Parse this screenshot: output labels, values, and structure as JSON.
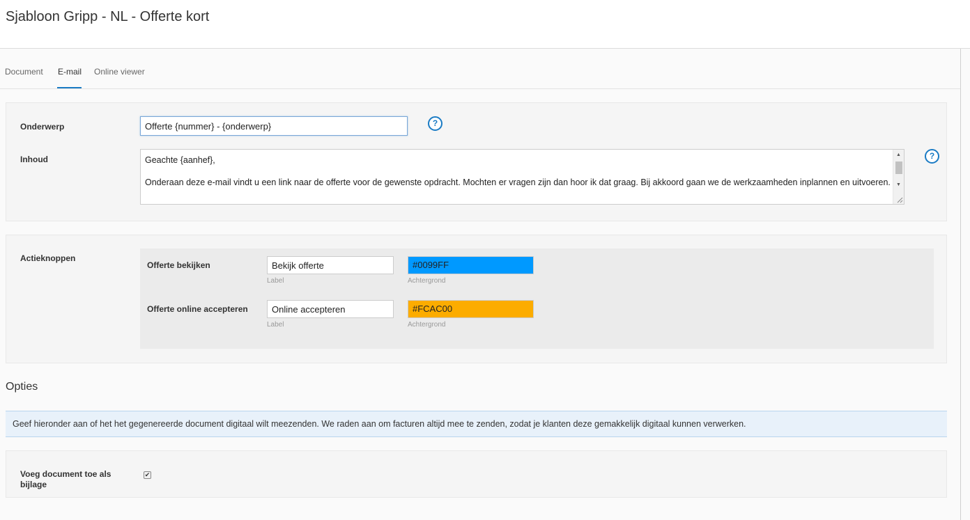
{
  "page": {
    "title": "Sjabloon Gripp - NL - Offerte kort"
  },
  "tabs": [
    {
      "label": "Document",
      "active": false
    },
    {
      "label": "E-mail",
      "active": true
    },
    {
      "label": "Online viewer",
      "active": false
    }
  ],
  "email": {
    "subject_label": "Onderwerp",
    "subject_value": "Offerte {nummer} - {onderwerp}",
    "content_label": "Inhoud",
    "content_lines": [
      "Geachte {aanhef},",
      "",
      "Onderaan deze e-mail vindt u een link naar de offerte voor de gewenste opdracht. Mochten er vragen zijn dan hoor ik dat graag. Bij akkoord gaan we de werkzaamheden inplannen en uitvoeren."
    ],
    "help_glyph": "?"
  },
  "actions": {
    "label": "Actieknoppen",
    "label_hint": "Label",
    "background_hint": "Achtergrond",
    "buttons": [
      {
        "name": "Offerte bekijken",
        "label": "Bekijk offerte",
        "color": "#0099FF"
      },
      {
        "name": "Offerte online accepteren",
        "label": "Online accepteren",
        "color": "#FCAC00"
      }
    ]
  },
  "options": {
    "heading": "Opties",
    "info": "Geef hieronder aan of het het gegenereerde document digitaal wilt meezenden. We raden aan om facturen altijd mee te zenden, zodat je klanten deze gemakkelijk digitaal kunnen verwerken.",
    "attach_label": "Voeg document toe als bijlage",
    "attach_checked": true
  },
  "colors": {
    "accent": "#1a7bc4",
    "info_background": "#e8f1fa"
  },
  "icons": {
    "help": "question-circle-icon",
    "checkbox": "checkmark-icon",
    "scroll_up": "arrow-up-icon",
    "scroll_down": "arrow-down-icon",
    "resize": "resize-grip-icon"
  }
}
